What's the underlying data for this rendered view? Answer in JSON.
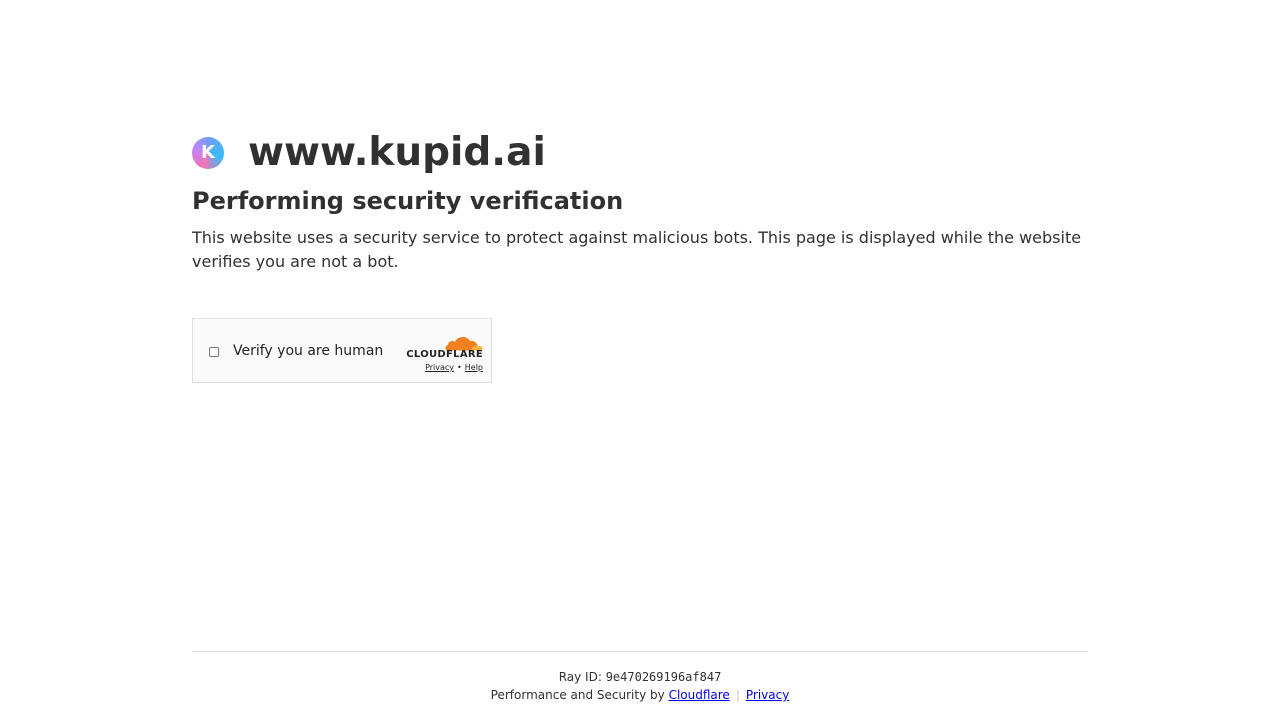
{
  "site": {
    "logo_letter": "K",
    "name": "www.kupid.ai"
  },
  "headline": "Performing security verification",
  "description": "This website uses a security service to protect against malicious bots. This page is displayed while the website verifies you are not a bot.",
  "widget": {
    "label": "Verify you are human",
    "brand": "CLOUDFLARE",
    "privacy_link": "Privacy",
    "separator": "•",
    "help_link": "Help"
  },
  "footer": {
    "ray_label": "Ray ID:",
    "ray_id": "9e470269196af847",
    "perf_text": "Performance and Security by",
    "cloudflare_link": "Cloudflare",
    "separator": "|",
    "privacy_link": "Privacy"
  },
  "colors": {
    "text": "#313131",
    "link": "#0000ee",
    "cloudflare_orange": "#f38020",
    "cloudflare_orange_light": "#faae40"
  }
}
